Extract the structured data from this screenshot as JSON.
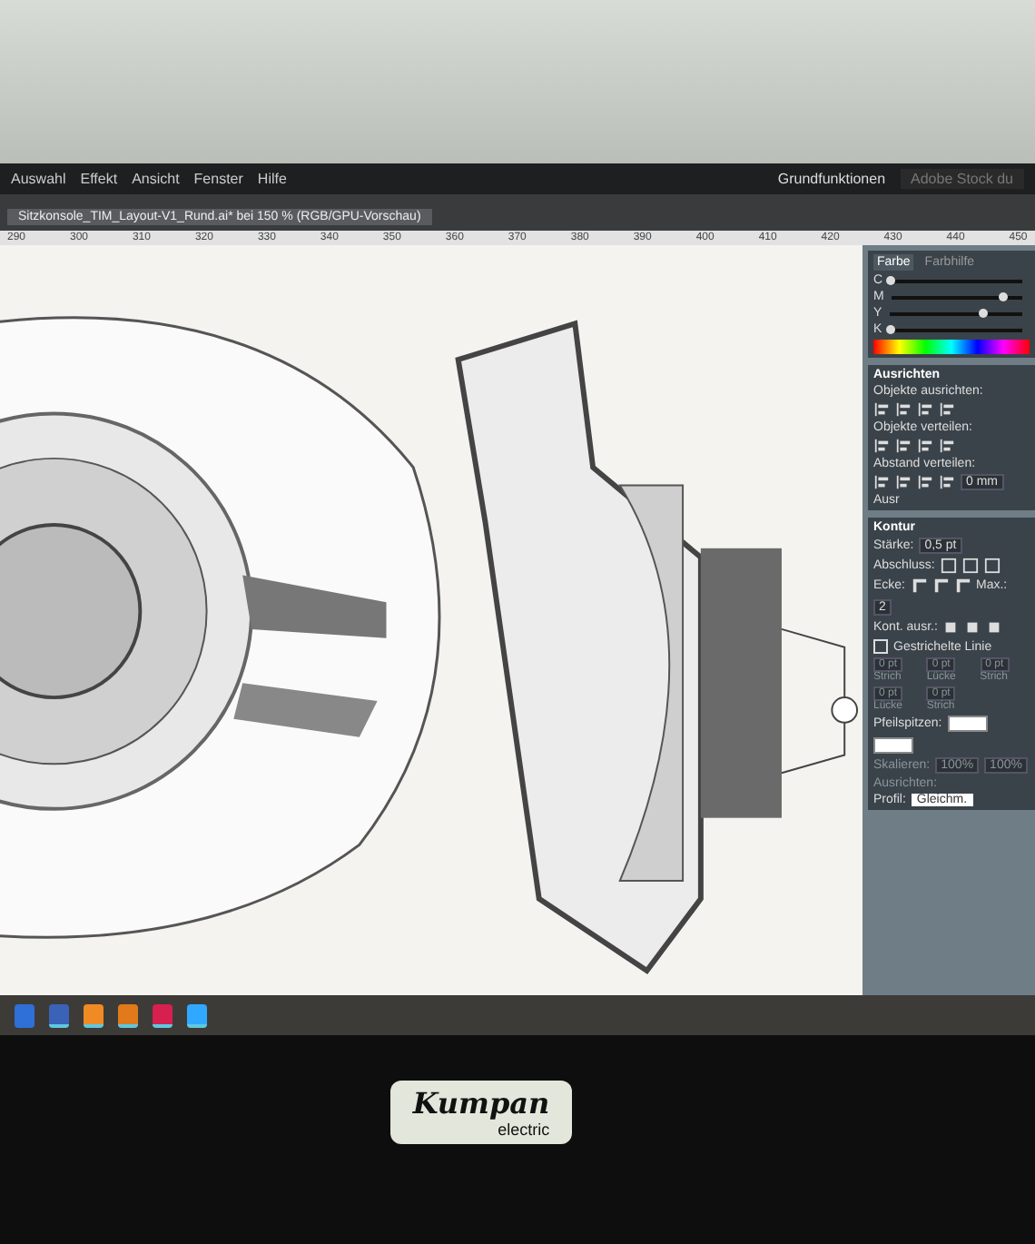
{
  "menu_bar": {
    "items": [
      "Auswahl",
      "Effekt",
      "Ansicht",
      "Fenster",
      "Hilfe"
    ],
    "workspace": "Grundfunktionen",
    "search_placeholder": "Adobe Stock du"
  },
  "document_tab": {
    "title": "Sitzkonsole_TIM_Layout-V1_Rund.ai* bei 150 % (RGB/GPU-Vorschau)",
    "selected": true
  },
  "ruler": {
    "ticks": [
      "290",
      "300",
      "310",
      "320",
      "330",
      "340",
      "350",
      "360",
      "370",
      "380",
      "390",
      "400",
      "410",
      "420",
      "430",
      "440",
      "450"
    ]
  },
  "color_panel": {
    "tabs": [
      {
        "label": "Farbe",
        "selected": true
      },
      {
        "label": "Farbhilfe",
        "selected": false
      }
    ],
    "channels": [
      {
        "name": "C",
        "level": 0.0
      },
      {
        "name": "M",
        "level": 0.85
      },
      {
        "name": "Y",
        "level": 0.7
      },
      {
        "name": "K",
        "level": 0.0
      }
    ]
  },
  "align_panel": {
    "title": "Ausrichten",
    "sections": [
      "Objekte ausrichten:",
      "Objekte verteilen:",
      "Abstand verteilen:"
    ],
    "spacing_value": "0 mm",
    "align_to": "Ausr"
  },
  "stroke_panel": {
    "title": "Kontur",
    "weight_label": "Stärke:",
    "weight": "0,5 pt",
    "cap_label": "Abschluss:",
    "corner_label": "Ecke:",
    "align_label": "Kont. ausr.:",
    "limit_label": "Max.:",
    "limit": "2",
    "dashed": {
      "label": "Gestrichelte Linie",
      "checked": false
    },
    "dash_fields": [
      {
        "value": "0 pt",
        "label": "Strich"
      },
      {
        "value": "0 pt",
        "label": "Lücke"
      },
      {
        "value": "0 pt",
        "label": "Strich"
      },
      {
        "value": "0 pt",
        "label": "Lücke"
      },
      {
        "value": "0 pt",
        "label": "Strich"
      }
    ],
    "arrow_label": "Pfeilspitzen:",
    "scale_label": "Skalieren:",
    "scale_values": [
      "100%",
      "100%"
    ],
    "arrow_align_label": "Ausrichten:",
    "profile_label": "Profil:",
    "profile": "Gleichm."
  },
  "taskbar": {
    "apps": [
      {
        "color": "#2f6fd8",
        "selected": false
      },
      {
        "color": "#3a63b8",
        "selected": true
      },
      {
        "color": "#f08a24",
        "selected": true
      },
      {
        "color": "#e07a1a",
        "selected": true
      },
      {
        "color": "#d6204f",
        "selected": true
      },
      {
        "color": "#31a8ff",
        "selected": true
      }
    ]
  },
  "bezel": {
    "brand": "Kumpan",
    "brand_sub": "electric"
  }
}
